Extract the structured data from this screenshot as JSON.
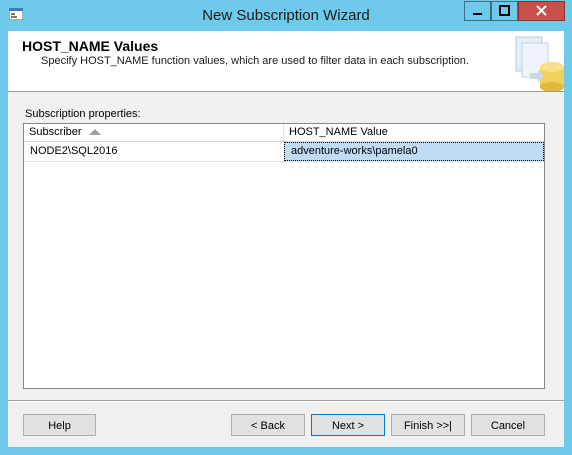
{
  "window": {
    "title": "New Subscription Wizard",
    "icon": "wizard-app-icon",
    "controls": [
      "minimize-icon",
      "maximize-icon",
      "close-icon"
    ]
  },
  "header": {
    "title": "HOST_NAME Values",
    "subtitle": "Specify HOST_NAME function values, which are used to filter data in each subscription."
  },
  "properties": {
    "label": "Subscription properties:",
    "columns": [
      "Subscriber",
      "HOST_NAME Value"
    ],
    "sort_icon": "sort-ascending-icon",
    "rows": [
      {
        "subscriber": "NODE2\\SQL2016",
        "host_name_value": "adventure-works\\pamela0"
      }
    ]
  },
  "buttons": {
    "help": "Help",
    "back": "< Back",
    "next": "Next >",
    "finish": "Finish >>|",
    "cancel": "Cancel"
  },
  "colors": {
    "window_frame": "#6fc9ea",
    "selected_cell": "#bfdcf4",
    "close_button": "#c7504a"
  }
}
